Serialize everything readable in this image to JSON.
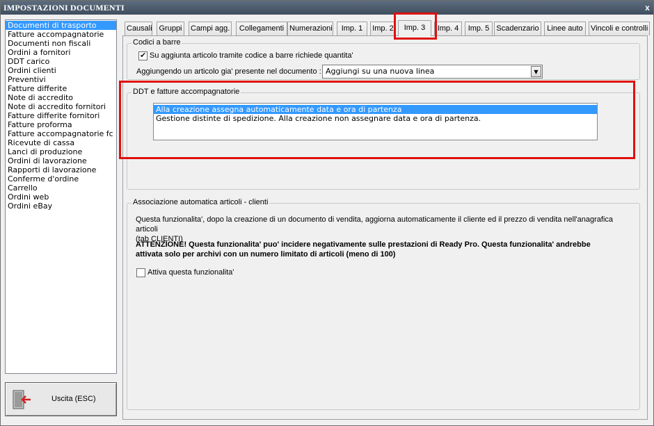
{
  "window": {
    "title": "IMPOSTAZIONI DOCUMENTI",
    "close_glyph": "x"
  },
  "doc_types": [
    "Documenti di trasporto",
    "Fatture accompagnatorie",
    "Documenti non fiscali",
    "Ordini a fornitori",
    "DDT carico",
    "Ordini clienti",
    "Preventivi",
    "Fatture differite",
    "Note di accredito",
    "Note di accredito fornitori",
    "Fatture differite fornitori",
    "Fatture proforma",
    "Fatture accompagnatorie fc",
    "Ricevute di cassa",
    "Lanci di produzione",
    "Ordini di lavorazione",
    "Rapporti di lavorazione",
    "Conferme d'ordine",
    "Carrello",
    "Ordini web",
    "Ordini eBay"
  ],
  "selected_doc_type": "Documenti di trasporto",
  "exit_button": {
    "label": "Uscita (ESC)",
    "icon": "exit-door-icon"
  },
  "tabs": [
    "Causali",
    "Gruppi",
    "Campi agg.",
    "Collegamenti",
    "Numerazioni",
    "Imp. 1",
    "Imp. 2",
    "Imp. 3",
    "Imp. 4",
    "Imp. 5",
    "Scadenzario",
    "Linee auto",
    "Vincoli e controlli"
  ],
  "active_tab": "Imp. 3",
  "barcode_group": {
    "title": "Codici a barre",
    "checkbox_label": "Su aggiunta articolo tramite codice a barre richiede quantita'",
    "checkbox_checked": true,
    "existing_article_label": "Aggiungendo un articolo gia' presente nel documento :",
    "existing_article_value": "Aggiungi su una nuova linea"
  },
  "ddt_group": {
    "title": "DDT e fatture accompagnatorie",
    "options": [
      "Alla creazione assegna automaticamente data e ora di partenza",
      "Gestione distinte di spedizione. Alla creazione non assegnare data e ora di partenza."
    ],
    "selected_option": 0
  },
  "assoc_group": {
    "title": "Associazione automatica articoli - clienti",
    "description_line1": "Questa funzionalita', dopo la creazione di un documento di vendita, aggiorna automaticamente il cliente ed il prezzo di vendita nell'anagrafica articoli",
    "description_line2": "(tab CLIENTI)",
    "warning_line1": "ATTENZIONE! Questa funzionalita' puo' incidere negativamente sulle prestazioni di Ready Pro. Questa funzionalita' andrebbe",
    "warning_line2": "attivata solo per archivi con un numero limitato di articoli (meno di 100)",
    "checkbox_label": "Attiva questa funzionalita'",
    "checkbox_checked": false
  },
  "colors": {
    "selection": "#3399ff",
    "highlight_box": "#e01010",
    "titlebar": "#4a5a6b"
  }
}
